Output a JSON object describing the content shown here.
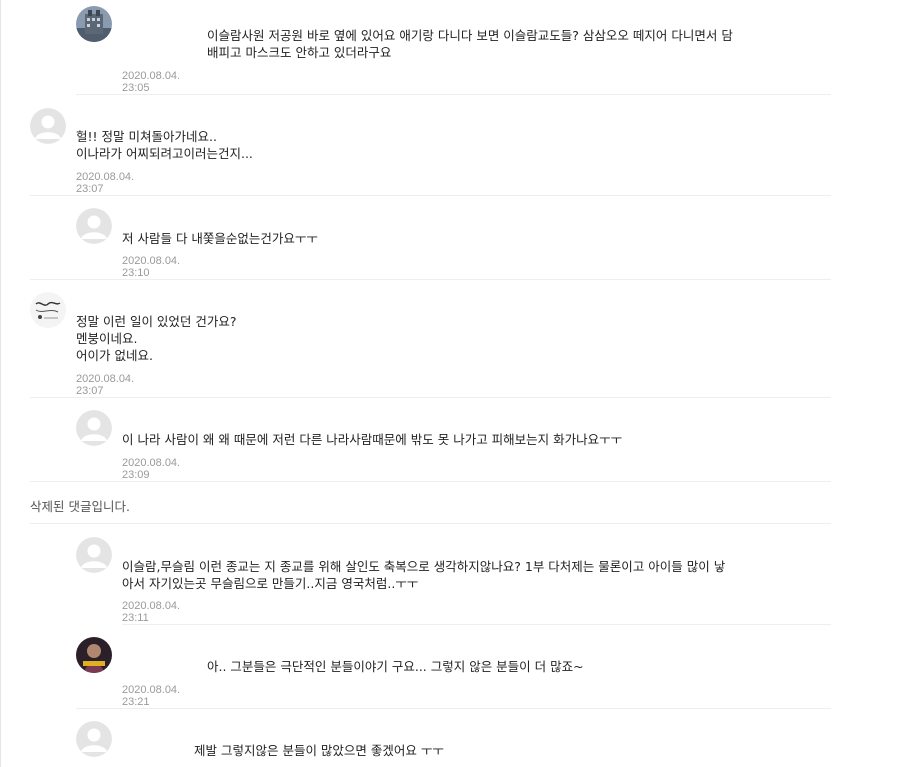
{
  "comments": [
    {
      "text": "이슬람사원 저공원 바로 옆에 있어요 애기랑 다니다 보면 이슬람교도들? 삼삼오오 떼지어 다니면서 담\n배피고 마스크도 안하고 있더라구요",
      "date": "2020.08.04. 23:05",
      "avatar": "building"
    },
    {
      "text": "헐!! 정말 미쳐돌아가네요..\n이나라가 어찌되려고이러는건지...",
      "date": "2020.08.04. 23:07",
      "avatar": "default"
    },
    {
      "text": "저 사람들 다 내쫓을순없는건가요ㅜㅜ",
      "date": "2020.08.04. 23:10",
      "avatar": "default"
    },
    {
      "text": "정말 이런 일이 있었던 건가요?\n멘붕이네요.\n어이가 없네요.",
      "date": "2020.08.04. 23:07",
      "avatar": "sketch"
    },
    {
      "text": "이 나라 사람이 왜 왜 때문에 저런 다른 나라사람때문에 밖도 못 나가고 피해보는지 화가나요ㅜㅜ",
      "date": "2020.08.04. 23:09",
      "avatar": "default"
    },
    {
      "text": "이슬람,무슬림 이런 종교는 지 종교를 위해 살인도 축복으로 생각하지않나요? 1부 다처제는 물론이고 아이들 많이 낳\n아서 자기있는곳 무슬림으로 만들기..지금 영국처럼..ㅜㅜ",
      "date": "2020.08.04. 23:11",
      "avatar": "default"
    },
    {
      "text": "아.. 그분들은 극단적인 분들이야기 구요... 그렇지 않은 분들이 더 많죠~",
      "date": "2020.08.04. 23:21",
      "avatar": "photo"
    },
    {
      "text": "제발 그렇지않은 분들이 많았으면 좋겠어요 ㅜㅜ",
      "date": "",
      "avatar": "default"
    }
  ],
  "deleted_text": "삭제된 댓글입니다."
}
